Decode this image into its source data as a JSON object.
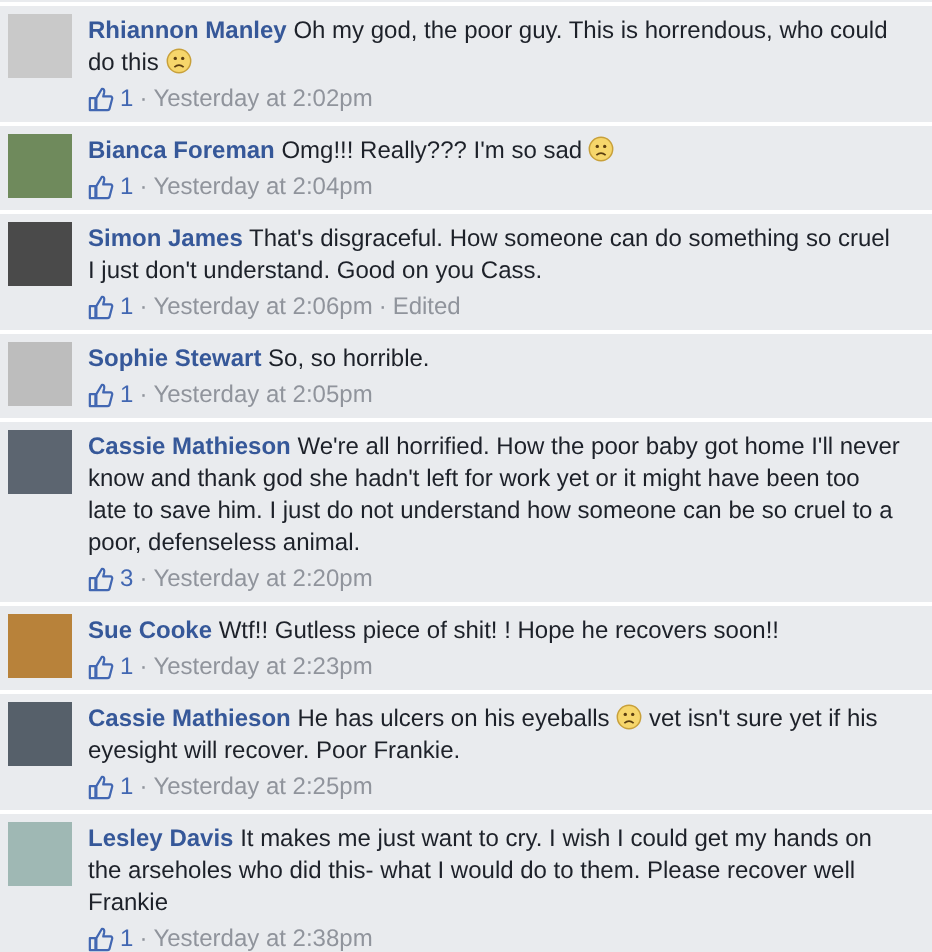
{
  "separator": "·",
  "comments": [
    {
      "author": "Rhiannon Manley",
      "body": [
        {
          "kind": "text",
          "text": "Oh my god, the poor guy. This is horrendous, who could do this "
        },
        {
          "kind": "emoji"
        }
      ],
      "likes": "1",
      "time": "Yesterday at 2:02pm"
    },
    {
      "author": "Bianca Foreman",
      "body": [
        {
          "kind": "text",
          "text": "Omg!!! Really??? I'm so sad "
        },
        {
          "kind": "emoji"
        }
      ],
      "likes": "1",
      "time": "Yesterday at 2:04pm"
    },
    {
      "author": "Simon James",
      "body": [
        {
          "kind": "text",
          "text": "That's disgraceful. How someone can do something so cruel I just don't understand. Good on you Cass."
        }
      ],
      "likes": "1",
      "time": "Yesterday at 2:06pm",
      "edited": "Edited"
    },
    {
      "author": "Sophie Stewart",
      "body": [
        {
          "kind": "text",
          "text": "So, so horrible."
        }
      ],
      "likes": "1",
      "time": "Yesterday at 2:05pm"
    },
    {
      "author": "Cassie Mathieson",
      "body": [
        {
          "kind": "text",
          "text": "We're all horrified. How the poor baby got home I'll never know and thank god she hadn't left for work yet or it might have been too late to save him. I just do not understand how someone can be so cruel to a poor, defenseless animal."
        }
      ],
      "likes": "3",
      "time": "Yesterday at 2:20pm"
    },
    {
      "author": "Sue Cooke",
      "body": [
        {
          "kind": "text",
          "text": "Wtf!! Gutless piece of shit! ! Hope he recovers soon!!"
        }
      ],
      "likes": "1",
      "time": "Yesterday at 2:23pm"
    },
    {
      "author": "Cassie Mathieson",
      "body": [
        {
          "kind": "text",
          "text": "He has ulcers on his eyeballs "
        },
        {
          "kind": "emoji"
        },
        {
          "kind": "text",
          "text": " vet isn't sure yet if his eyesight will recover. Poor Frankie."
        }
      ],
      "likes": "1",
      "time": "Yesterday at 2:25pm"
    },
    {
      "author": "Lesley Davis",
      "body": [
        {
          "kind": "text",
          "text": "It makes me just want to cry. I wish I could get my hands on the arseholes who did this- what I would do to them. Please recover well Frankie"
        }
      ],
      "likes": "1",
      "time": "Yesterday at 2:38pm"
    }
  ]
}
